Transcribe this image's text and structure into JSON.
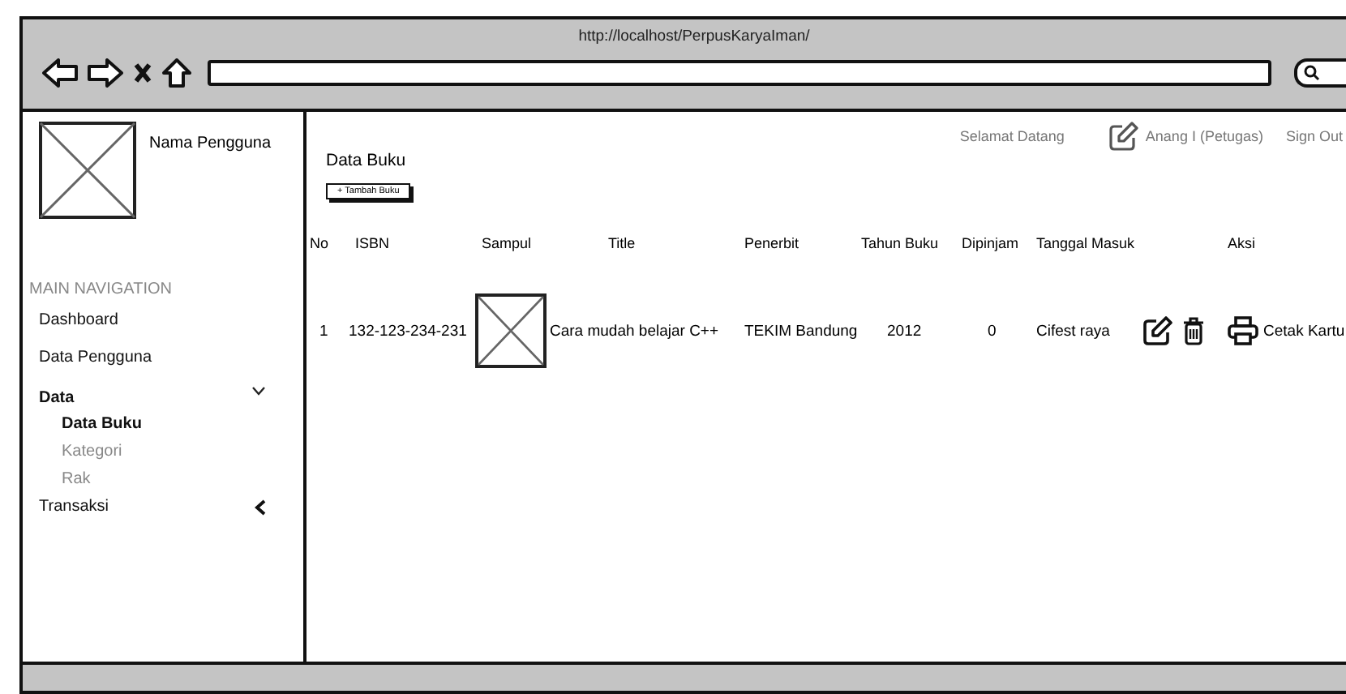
{
  "browser": {
    "url": "http://localhost/PerpusKaryaIman/"
  },
  "sidebar": {
    "user_name": "Nama Pengguna",
    "section_title": "MAIN NAVIGATION",
    "items": [
      {
        "label": "Dashboard",
        "selected": false
      },
      {
        "label": "Data Pengguna",
        "selected": false
      },
      {
        "label": "Data",
        "selected": true,
        "expanded": true,
        "children": [
          {
            "label": "Data  Buku",
            "selected": true
          },
          {
            "label": "Kategori",
            "selected": false
          },
          {
            "label": "Rak",
            "selected": false
          }
        ]
      },
      {
        "label": "Transaksi",
        "selected": false,
        "expanded": false
      }
    ]
  },
  "header": {
    "greeting": "Selamat Datang",
    "user": "Anang I (Petugas)",
    "sign_out": "Sign Out"
  },
  "page_title": "Data Buku",
  "add_button": "+ Tambah Buku",
  "table": {
    "columns": [
      "No",
      "ISBN",
      "Sampul",
      "Title",
      "Penerbit",
      "Tahun Buku",
      "Dipinjam",
      "Tanggal Masuk",
      "Aksi"
    ],
    "rows": [
      {
        "no": "1",
        "isbn": "132-123-234-231",
        "title": "Cara mudah belajar C++",
        "penerbit": "TEKIM Bandung",
        "tahun": "2012",
        "dipinjam": "0",
        "tanggal_masuk": "Cifest raya",
        "print_label": "Cetak Kartu"
      }
    ]
  }
}
